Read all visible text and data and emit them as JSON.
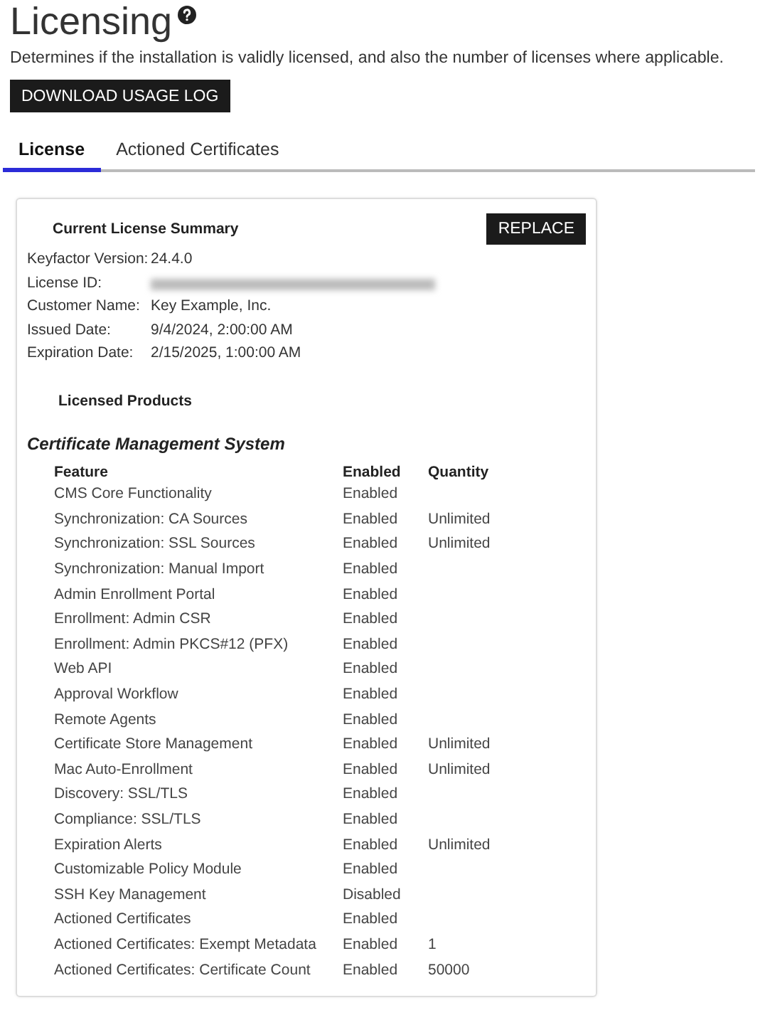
{
  "page": {
    "title": "Licensing",
    "description": "Determines if the installation is validly licensed, and also the number of licenses where applicable.",
    "download_button": "DOWNLOAD USAGE LOG"
  },
  "tabs": [
    {
      "label": "License",
      "selected": true
    },
    {
      "label": "Actioned Certificates",
      "selected": false
    }
  ],
  "summary": {
    "title": "Current License Summary",
    "replace_button": "REPLACE",
    "fields": [
      {
        "label": "Keyfactor Version:",
        "value": "24.4.0",
        "redacted": false
      },
      {
        "label": "License ID:",
        "redacted": true
      },
      {
        "label": "Customer Name:",
        "value": "Key Example, Inc.",
        "redacted": false
      },
      {
        "label": "Issued Date:",
        "value": "9/4/2024, 2:00:00 AM",
        "redacted": false
      },
      {
        "label": "Expiration Date:",
        "value": "2/15/2025, 1:00:00 AM",
        "redacted": false
      }
    ]
  },
  "products": {
    "title": "Licensed Products",
    "product_name": "Certificate Management System",
    "columns": [
      "Feature",
      "Enabled",
      "Quantity"
    ],
    "rows": [
      {
        "feature": "CMS Core Functionality",
        "enabled": "Enabled"
      },
      {
        "feature": "Synchronization: CA Sources",
        "enabled": "Enabled",
        "quantity": "Unlimited"
      },
      {
        "feature": "Synchronization: SSL Sources",
        "enabled": "Enabled",
        "quantity": "Unlimited"
      },
      {
        "feature": "Synchronization: Manual Import",
        "enabled": "Enabled"
      },
      {
        "feature": "Admin Enrollment Portal",
        "enabled": "Enabled"
      },
      {
        "feature": "Enrollment: Admin CSR",
        "enabled": "Enabled"
      },
      {
        "feature": "Enrollment: Admin PKCS#12 (PFX)",
        "enabled": "Enabled"
      },
      {
        "feature": "Web API",
        "enabled": "Enabled"
      },
      {
        "feature": "Approval Workflow",
        "enabled": "Enabled"
      },
      {
        "feature": "Remote Agents",
        "enabled": "Enabled"
      },
      {
        "feature": "Certificate Store Management",
        "enabled": "Enabled",
        "quantity": "Unlimited"
      },
      {
        "feature": "Mac Auto-Enrollment",
        "enabled": "Enabled",
        "quantity": "Unlimited"
      },
      {
        "feature": "Discovery: SSL/TLS",
        "enabled": "Enabled"
      },
      {
        "feature": "Compliance: SSL/TLS",
        "enabled": "Enabled"
      },
      {
        "feature": "Expiration Alerts",
        "enabled": "Enabled",
        "quantity": "Unlimited"
      },
      {
        "feature": "Customizable Policy Module",
        "enabled": "Enabled"
      },
      {
        "feature": "SSH Key Management",
        "enabled": "Disabled"
      },
      {
        "feature": "Actioned Certificates",
        "enabled": "Enabled"
      },
      {
        "feature": "Actioned Certificates: Exempt Metadata",
        "enabled": "Enabled",
        "quantity": "1"
      },
      {
        "feature": "Actioned Certificates: Certificate Count",
        "enabled": "Enabled",
        "quantity": "50000"
      }
    ]
  }
}
